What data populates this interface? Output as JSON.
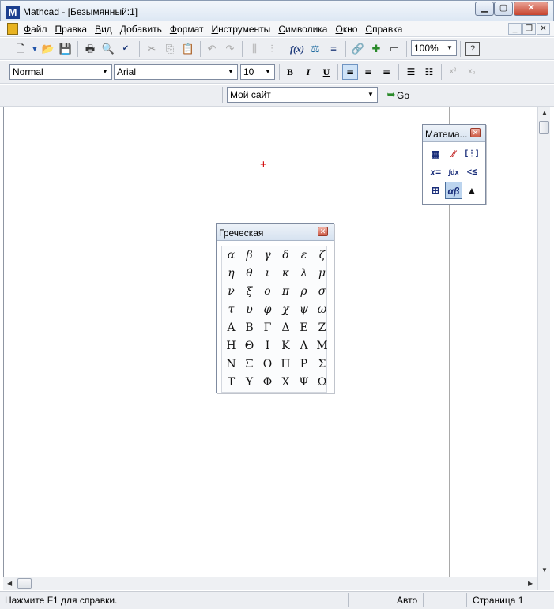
{
  "window": {
    "title": "Mathcad - [Безымянный:1]",
    "app_logo": "M",
    "minimize_icon": "minimize-icon",
    "maximize_icon": "maximize-icon",
    "close_icon": "close-icon"
  },
  "menubar": {
    "items": [
      "Файл",
      "Правка",
      "Вид",
      "Добавить",
      "Формат",
      "Инструменты",
      "Символика",
      "Окно",
      "Справка"
    ]
  },
  "standard_toolbar": {
    "zoom_value": "100%"
  },
  "formatting_toolbar": {
    "style_value": "Normal",
    "font_value": "Arial",
    "size_value": "10",
    "bold_label": "B",
    "italic_label": "I",
    "underline_label": "U",
    "superscript_label": "x²",
    "subscript_label": "x₂"
  },
  "resource_toolbar": {
    "site_value": "Мой сайт",
    "go_label": "Go"
  },
  "math_palette": {
    "title": "Матема...",
    "calculator_label": "▦",
    "graph_label": "⁄⁄",
    "matrix_label": "[⋮]",
    "evaluation_label": "x=",
    "calculus_label": "∫dx",
    "boolean_label": "<≤",
    "programming_label": "⊞",
    "greek_label": "αβ",
    "symbolic_label": "▲"
  },
  "greek_palette": {
    "title": "Греческая",
    "lower": [
      "α",
      "β",
      "γ",
      "δ",
      "ε",
      "ζ",
      "η",
      "θ",
      "ι",
      "κ",
      "λ",
      "μ",
      "ν",
      "ξ",
      "ο",
      "π",
      "ρ",
      "σ",
      "τ",
      "υ",
      "φ",
      "χ",
      "ψ",
      "ω"
    ],
    "upper": [
      "Α",
      "Β",
      "Γ",
      "Δ",
      "Ε",
      "Ζ",
      "Η",
      "Θ",
      "Ι",
      "Κ",
      "Λ",
      "Μ",
      "Ν",
      "Ξ",
      "Ο",
      "Π",
      "Ρ",
      "Σ",
      "Τ",
      "Υ",
      "Φ",
      "Χ",
      "Ψ",
      "Ω"
    ]
  },
  "statusbar": {
    "help_text": "Нажмите F1 для справки.",
    "mode": "Авто",
    "page": "Страница 1"
  }
}
